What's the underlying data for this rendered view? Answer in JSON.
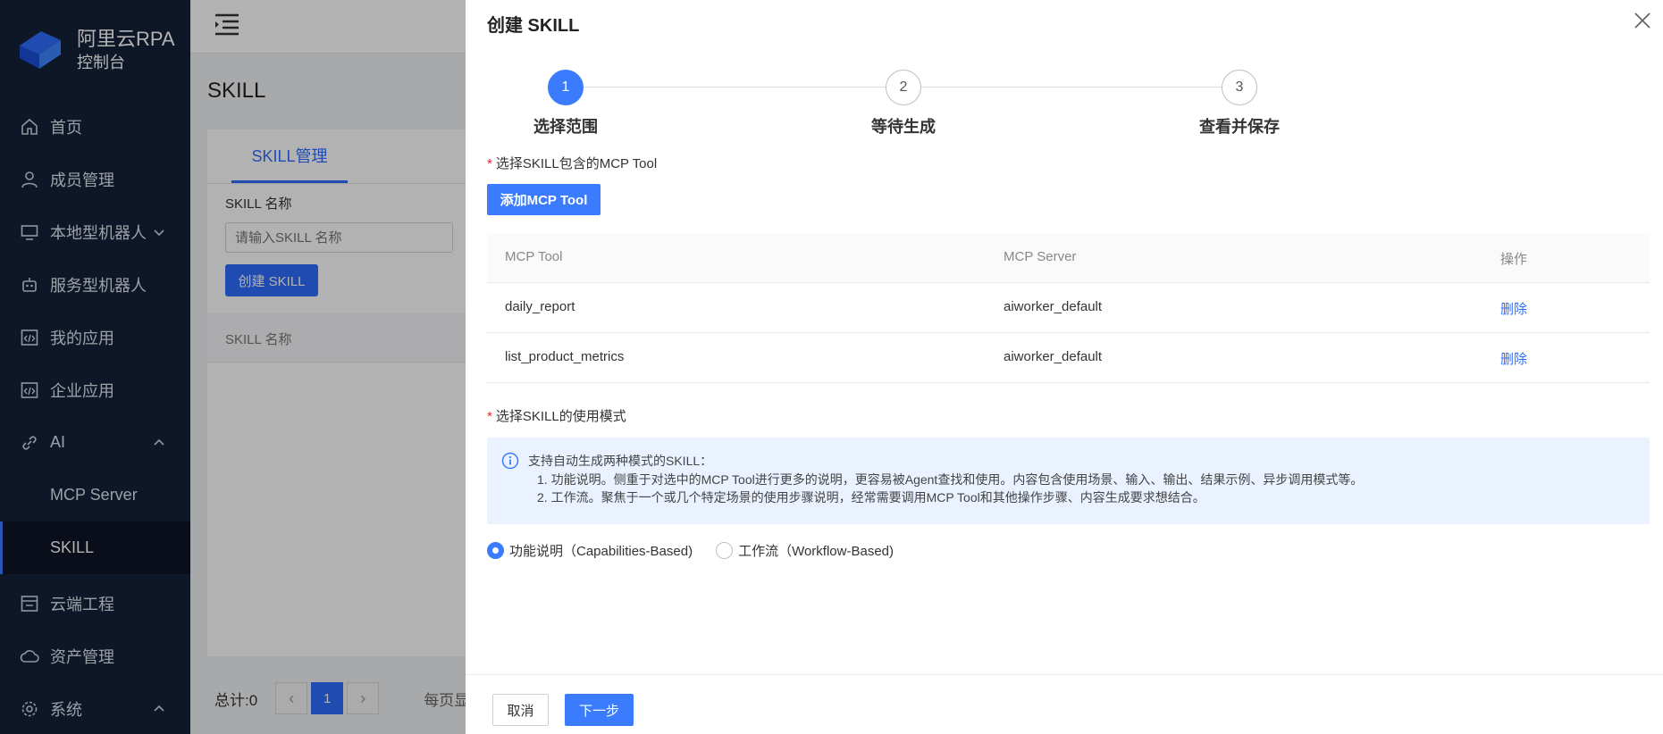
{
  "sidebar": {
    "brand_title": "阿里云RPA",
    "brand_sub": "控制台",
    "items": [
      {
        "label": "首页"
      },
      {
        "label": "成员管理"
      },
      {
        "label": "本地型机器人"
      },
      {
        "label": "服务型机器人"
      },
      {
        "label": "我的应用"
      },
      {
        "label": "企业应用"
      },
      {
        "label": "AI"
      },
      {
        "label": "云端工程"
      },
      {
        "label": "资产管理"
      },
      {
        "label": "系统"
      }
    ],
    "ai_sub": [
      {
        "label": "MCP Server"
      },
      {
        "label": "SKILL"
      }
    ]
  },
  "main": {
    "page_title": "SKILL",
    "tab_label": "SKILL管理",
    "field_label": "SKILL 名称",
    "field_placeholder": "请输入SKILL 名称",
    "create_button": "创建 SKILL",
    "table_header": "SKILL 名称",
    "pager": {
      "total": "总计:0",
      "current_page": "1",
      "per_page": "每页显"
    }
  },
  "drawer": {
    "title": "创建 SKILL",
    "steps": [
      {
        "num": "1",
        "label": "选择范围"
      },
      {
        "num": "2",
        "label": "等待生成"
      },
      {
        "num": "3",
        "label": "查看并保存"
      }
    ],
    "tool_section_label": "选择SKILL包含的MCP Tool",
    "add_button": "添加MCP Tool",
    "table": {
      "headers": [
        "MCP Tool",
        "MCP Server",
        "操作"
      ],
      "rows": [
        {
          "tool": "daily_report",
          "server": "aiworker_default",
          "action": "删除"
        },
        {
          "tool": "list_product_metrics",
          "server": "aiworker_default",
          "action": "删除"
        }
      ]
    },
    "mode_section_label": "选择SKILL的使用模式",
    "info": {
      "line1": "支持自动生成两种模式的SKILL：",
      "line2": "1. 功能说明。侧重于对选中的MCP Tool进行更多的说明，更容易被Agent查找和使用。内容包含使用场景、输入、输出、结果示例、异步调用模式等。",
      "line3": "2. 工作流。聚焦于一个或几个特定场景的使用步骤说明，经常需要调用MCP Tool和其他操作步骤、内容生成要求想结合。"
    },
    "modes": [
      {
        "label": "功能说明（Capabilities-Based)",
        "selected": true
      },
      {
        "label": "工作流（Workflow-Based)",
        "selected": false
      }
    ],
    "cancel_button": "取消",
    "next_button": "下一步"
  },
  "colors": {
    "accent": "#3b7cff",
    "sidebar_bg": "#15213a",
    "required": "#f5222d"
  }
}
